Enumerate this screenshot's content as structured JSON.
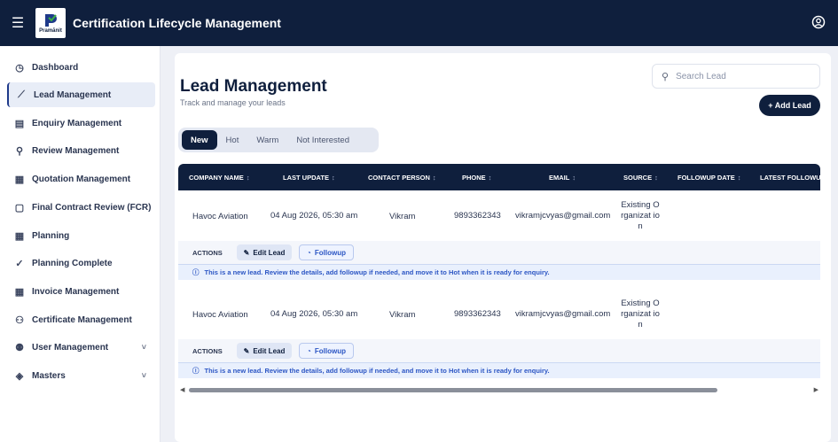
{
  "header": {
    "menu_icon": "hamburger-icon",
    "logo_text": "Pramānit",
    "title": "Certification Lifecycle Management",
    "profile_icon": "account-icon"
  },
  "sidebar": {
    "items": [
      {
        "label": "Dashboard",
        "icon": "clock-icon",
        "glyph": "◷"
      },
      {
        "label": "Lead Management",
        "icon": "trend-icon",
        "glyph": "⟋",
        "active": true
      },
      {
        "label": "Enquiry Management",
        "icon": "clipboard-icon",
        "glyph": "▤"
      },
      {
        "label": "Review Management",
        "icon": "search-icon",
        "glyph": "⚲"
      },
      {
        "label": "Quotation Management",
        "icon": "receipt-icon",
        "glyph": "▦"
      },
      {
        "label": "Final Contract Review (FCR)",
        "icon": "document-icon",
        "glyph": "▢"
      },
      {
        "label": "Planning",
        "icon": "calendar-icon",
        "glyph": "▦"
      },
      {
        "label": "Planning Complete",
        "icon": "check-circle-icon",
        "glyph": "✓"
      },
      {
        "label": "Invoice Management",
        "icon": "invoice-icon",
        "glyph": "▦"
      },
      {
        "label": "Certificate Management",
        "icon": "award-icon",
        "glyph": "⚇"
      },
      {
        "label": "User Management",
        "icon": "users-icon",
        "glyph": "⚉",
        "chevron": "˅"
      },
      {
        "label": "Masters",
        "icon": "layers-icon",
        "glyph": "◈",
        "chevron": "˅"
      }
    ]
  },
  "main": {
    "title": "Lead Management",
    "subtitle": "Track and manage your leads",
    "search_placeholder": "Search Lead",
    "add_button": "+ Add Lead",
    "tabs": [
      {
        "label": "New",
        "active": true
      },
      {
        "label": "Hot"
      },
      {
        "label": "Warm"
      },
      {
        "label": "Not Interested"
      }
    ]
  },
  "table": {
    "sort_glyph": "↕",
    "columns": [
      "COMPANY NAME",
      "LAST UPDATE",
      "CONTACT PERSON",
      "PHONE",
      "EMAIL",
      "SOURCE",
      "FOLLOWUP DATE",
      "LATEST FOLLOWUP"
    ],
    "rows": [
      {
        "company": "Havoc Aviation",
        "last_update": "04 Aug 2026, 05:30 am",
        "contact": "Vikram",
        "phone": "9893362343",
        "email": "vikramjcvyas@gmail.com",
        "source": "Existing Organizat ion",
        "followup_date": "",
        "latest_followup": ""
      },
      {
        "company": "Havoc Aviation",
        "last_update": "04 Aug 2026, 05:30 am",
        "contact": "Vikram",
        "phone": "9893362343",
        "email": "vikramjcvyas@gmail.com",
        "source": "Existing Organizat ion",
        "followup_date": "",
        "latest_followup": ""
      }
    ],
    "actions_label": "ACTIONS",
    "edit_label": "Edit Lead",
    "followup_label": "Followup",
    "note": "This is a new lead. Review the details, add followup if needed, and move it to Hot when it is ready for enquiry."
  },
  "colors": {
    "navy": "#0f1f3d",
    "accent_blue": "#2c56c4",
    "page_bg": "#eef0f6"
  }
}
